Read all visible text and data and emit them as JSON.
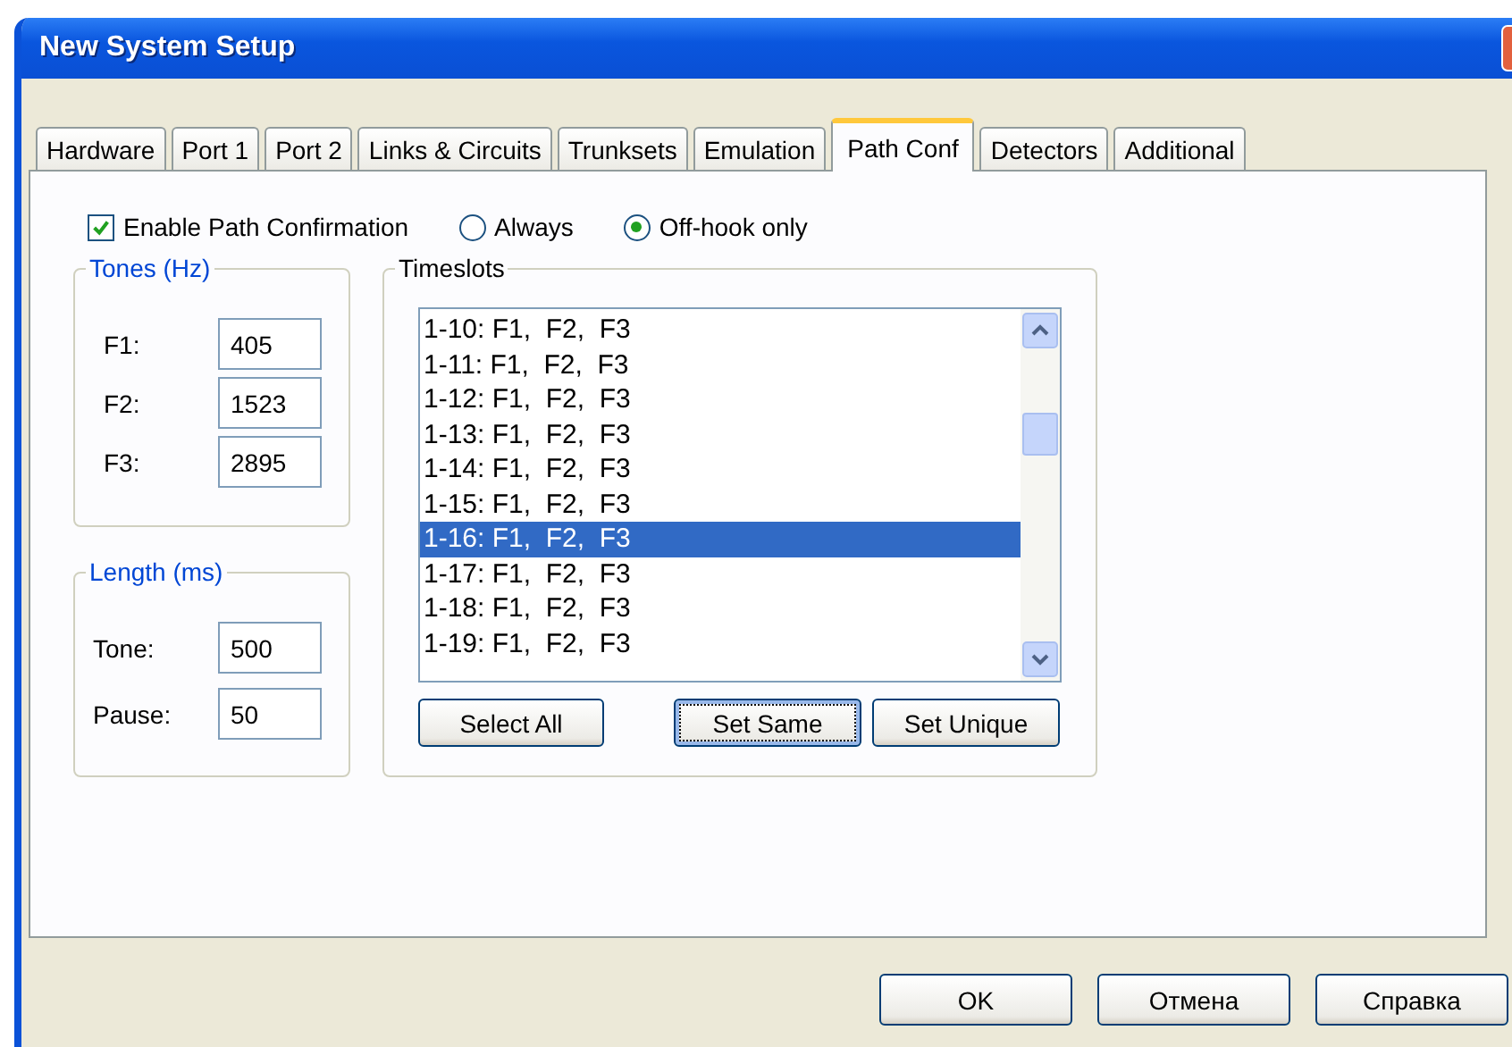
{
  "window": {
    "title": "New System Setup"
  },
  "tabs": [
    {
      "label": "Hardware",
      "selected": false
    },
    {
      "label": "Port 1",
      "selected": false
    },
    {
      "label": "Port 2",
      "selected": false
    },
    {
      "label": "Links & Circuits",
      "selected": false
    },
    {
      "label": "Trunksets",
      "selected": false
    },
    {
      "label": "Emulation",
      "selected": false
    },
    {
      "label": "Path Conf",
      "selected": true
    },
    {
      "label": "Detectors",
      "selected": false
    },
    {
      "label": "Additional",
      "selected": false
    }
  ],
  "enable_path_confirmation": {
    "label": "Enable Path Confirmation",
    "checked": true
  },
  "mode": [
    {
      "label": "Always",
      "selected": false
    },
    {
      "label": "Off-hook only",
      "selected": true
    }
  ],
  "tones": {
    "title": "Tones (Hz)",
    "fields": [
      {
        "label": "F1:",
        "value": "405"
      },
      {
        "label": "F2:",
        "value": "1523"
      },
      {
        "label": "F3:",
        "value": "2895"
      }
    ]
  },
  "length": {
    "title": "Length (ms)",
    "fields": [
      {
        "label": "Tone:",
        "value": "500"
      },
      {
        "label": "Pause:",
        "value": "50"
      }
    ]
  },
  "timeslots": {
    "title": "Timeslots",
    "items": [
      {
        "label": "1-10: F1,  F2,  F3",
        "selected": false
      },
      {
        "label": "1-11: F1,  F2,  F3",
        "selected": false
      },
      {
        "label": "1-12: F1,  F2,  F3",
        "selected": false
      },
      {
        "label": "1-13: F1,  F2,  F3",
        "selected": false
      },
      {
        "label": "1-14: F1,  F2,  F3",
        "selected": false
      },
      {
        "label": "1-15: F1,  F2,  F3",
        "selected": false
      },
      {
        "label": "1-16: F1,  F2,  F3",
        "selected": true
      },
      {
        "label": "1-17: F1,  F2,  F3",
        "selected": false
      },
      {
        "label": "1-18: F1,  F2,  F3",
        "selected": false
      },
      {
        "label": "1-19: F1,  F2,  F3",
        "selected": false
      }
    ],
    "buttons": [
      {
        "label": "Select All",
        "focused": false
      },
      {
        "label": "Set Same",
        "focused": true
      },
      {
        "label": "Set Unique",
        "focused": false
      }
    ]
  },
  "buttons": [
    "OK",
    "Отмена",
    "Справка"
  ]
}
